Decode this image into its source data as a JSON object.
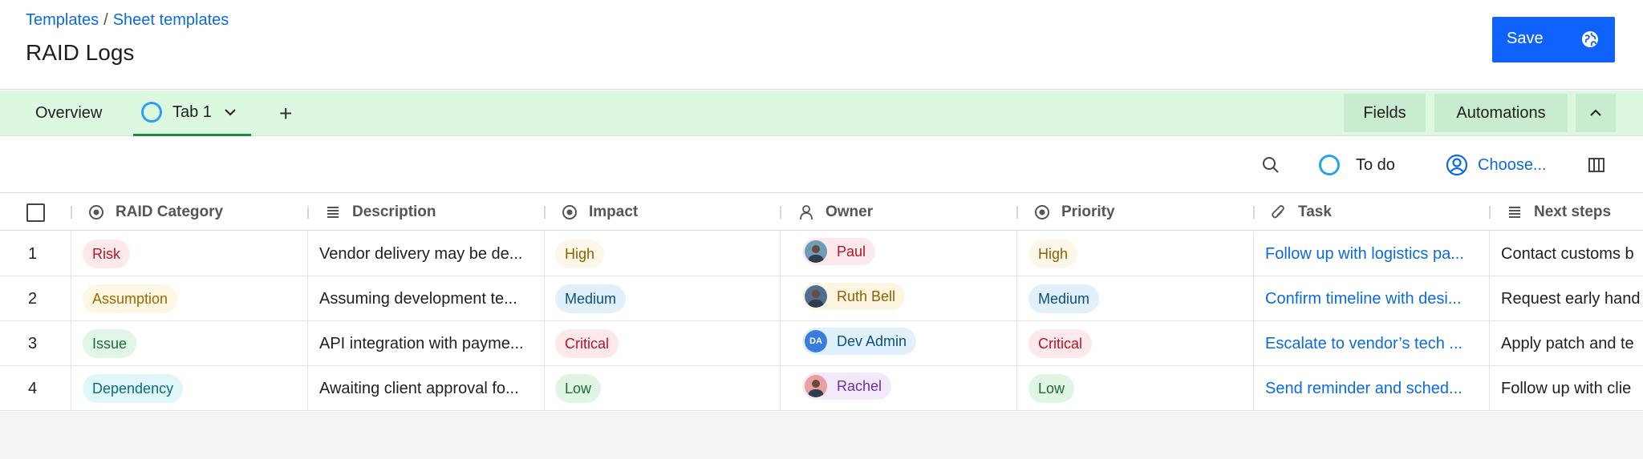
{
  "breadcrumb": {
    "root": "Templates",
    "separator": "/",
    "current": "Sheet templates"
  },
  "page_title": "RAID Logs",
  "save": {
    "label": "Save",
    "icon": "globe-icon",
    "color": "#0f62fe"
  },
  "tabs": {
    "overview": "Overview",
    "active": "Tab 1",
    "add": "+"
  },
  "tab_actions": {
    "fields": "Fields",
    "automations": "Automations"
  },
  "toolbar": {
    "status": "To do",
    "assignee": "Choose..."
  },
  "columns": [
    {
      "label": "RAID Category",
      "icon": "status-icon"
    },
    {
      "label": "Description",
      "icon": "text-lines-icon"
    },
    {
      "label": "Impact",
      "icon": "status-icon"
    },
    {
      "label": "Owner",
      "icon": "person-icon"
    },
    {
      "label": "Priority",
      "icon": "status-icon"
    },
    {
      "label": "Task",
      "icon": "paperclip-icon"
    },
    {
      "label": "Next steps",
      "icon": "text-lines-icon"
    }
  ],
  "rows": [
    {
      "num": "1",
      "category": "Risk",
      "description": "Vendor delivery may be de...",
      "impact": "High",
      "owner": "Paul",
      "priority": "High",
      "task": "Follow up with logistics pa...",
      "next_steps": "Contact customs b"
    },
    {
      "num": "2",
      "category": "Assumption",
      "description": "Assuming development te...",
      "impact": "Medium",
      "owner": "Ruth Bell",
      "priority": "Medium",
      "task": "Confirm timeline with desi...",
      "next_steps": "Request early hand"
    },
    {
      "num": "3",
      "category": "Issue",
      "description": "API integration with payme...",
      "impact": "Critical",
      "owner": "Dev Admin",
      "owner_initials": "DA",
      "priority": "Critical",
      "task": "Escalate to vendor’s tech ...",
      "next_steps": "Apply patch and te"
    },
    {
      "num": "4",
      "category": "Dependency",
      "description": "Awaiting client approval fo...",
      "impact": "Low",
      "owner": "Rachel",
      "priority": "Low",
      "task": "Send reminder and sched...",
      "next_steps": "Follow up with clie"
    }
  ],
  "colors": {
    "tabbar_bg": "#dcf8e0",
    "link": "#0b6bdb",
    "risk_bg": "#fde8ea",
    "risk_fg": "#b3152a",
    "assumption_bg": "#fdf7e3",
    "assumption_fg": "#9a6b00",
    "issue_bg": "#e1f6e6",
    "issue_fg": "#1c6b33",
    "dependency_bg": "#dff7f9",
    "dependency_fg": "#0b6b7a",
    "high_bg": "#fdf7e9",
    "high_fg": "#8a6200",
    "medium_bg": "#e0f1fb",
    "medium_fg": "#0d4f7a",
    "critical_bg": "#fde9ea",
    "critical_fg": "#b3152a",
    "low_bg": "#dff6e4",
    "low_fg": "#1c6b33"
  }
}
